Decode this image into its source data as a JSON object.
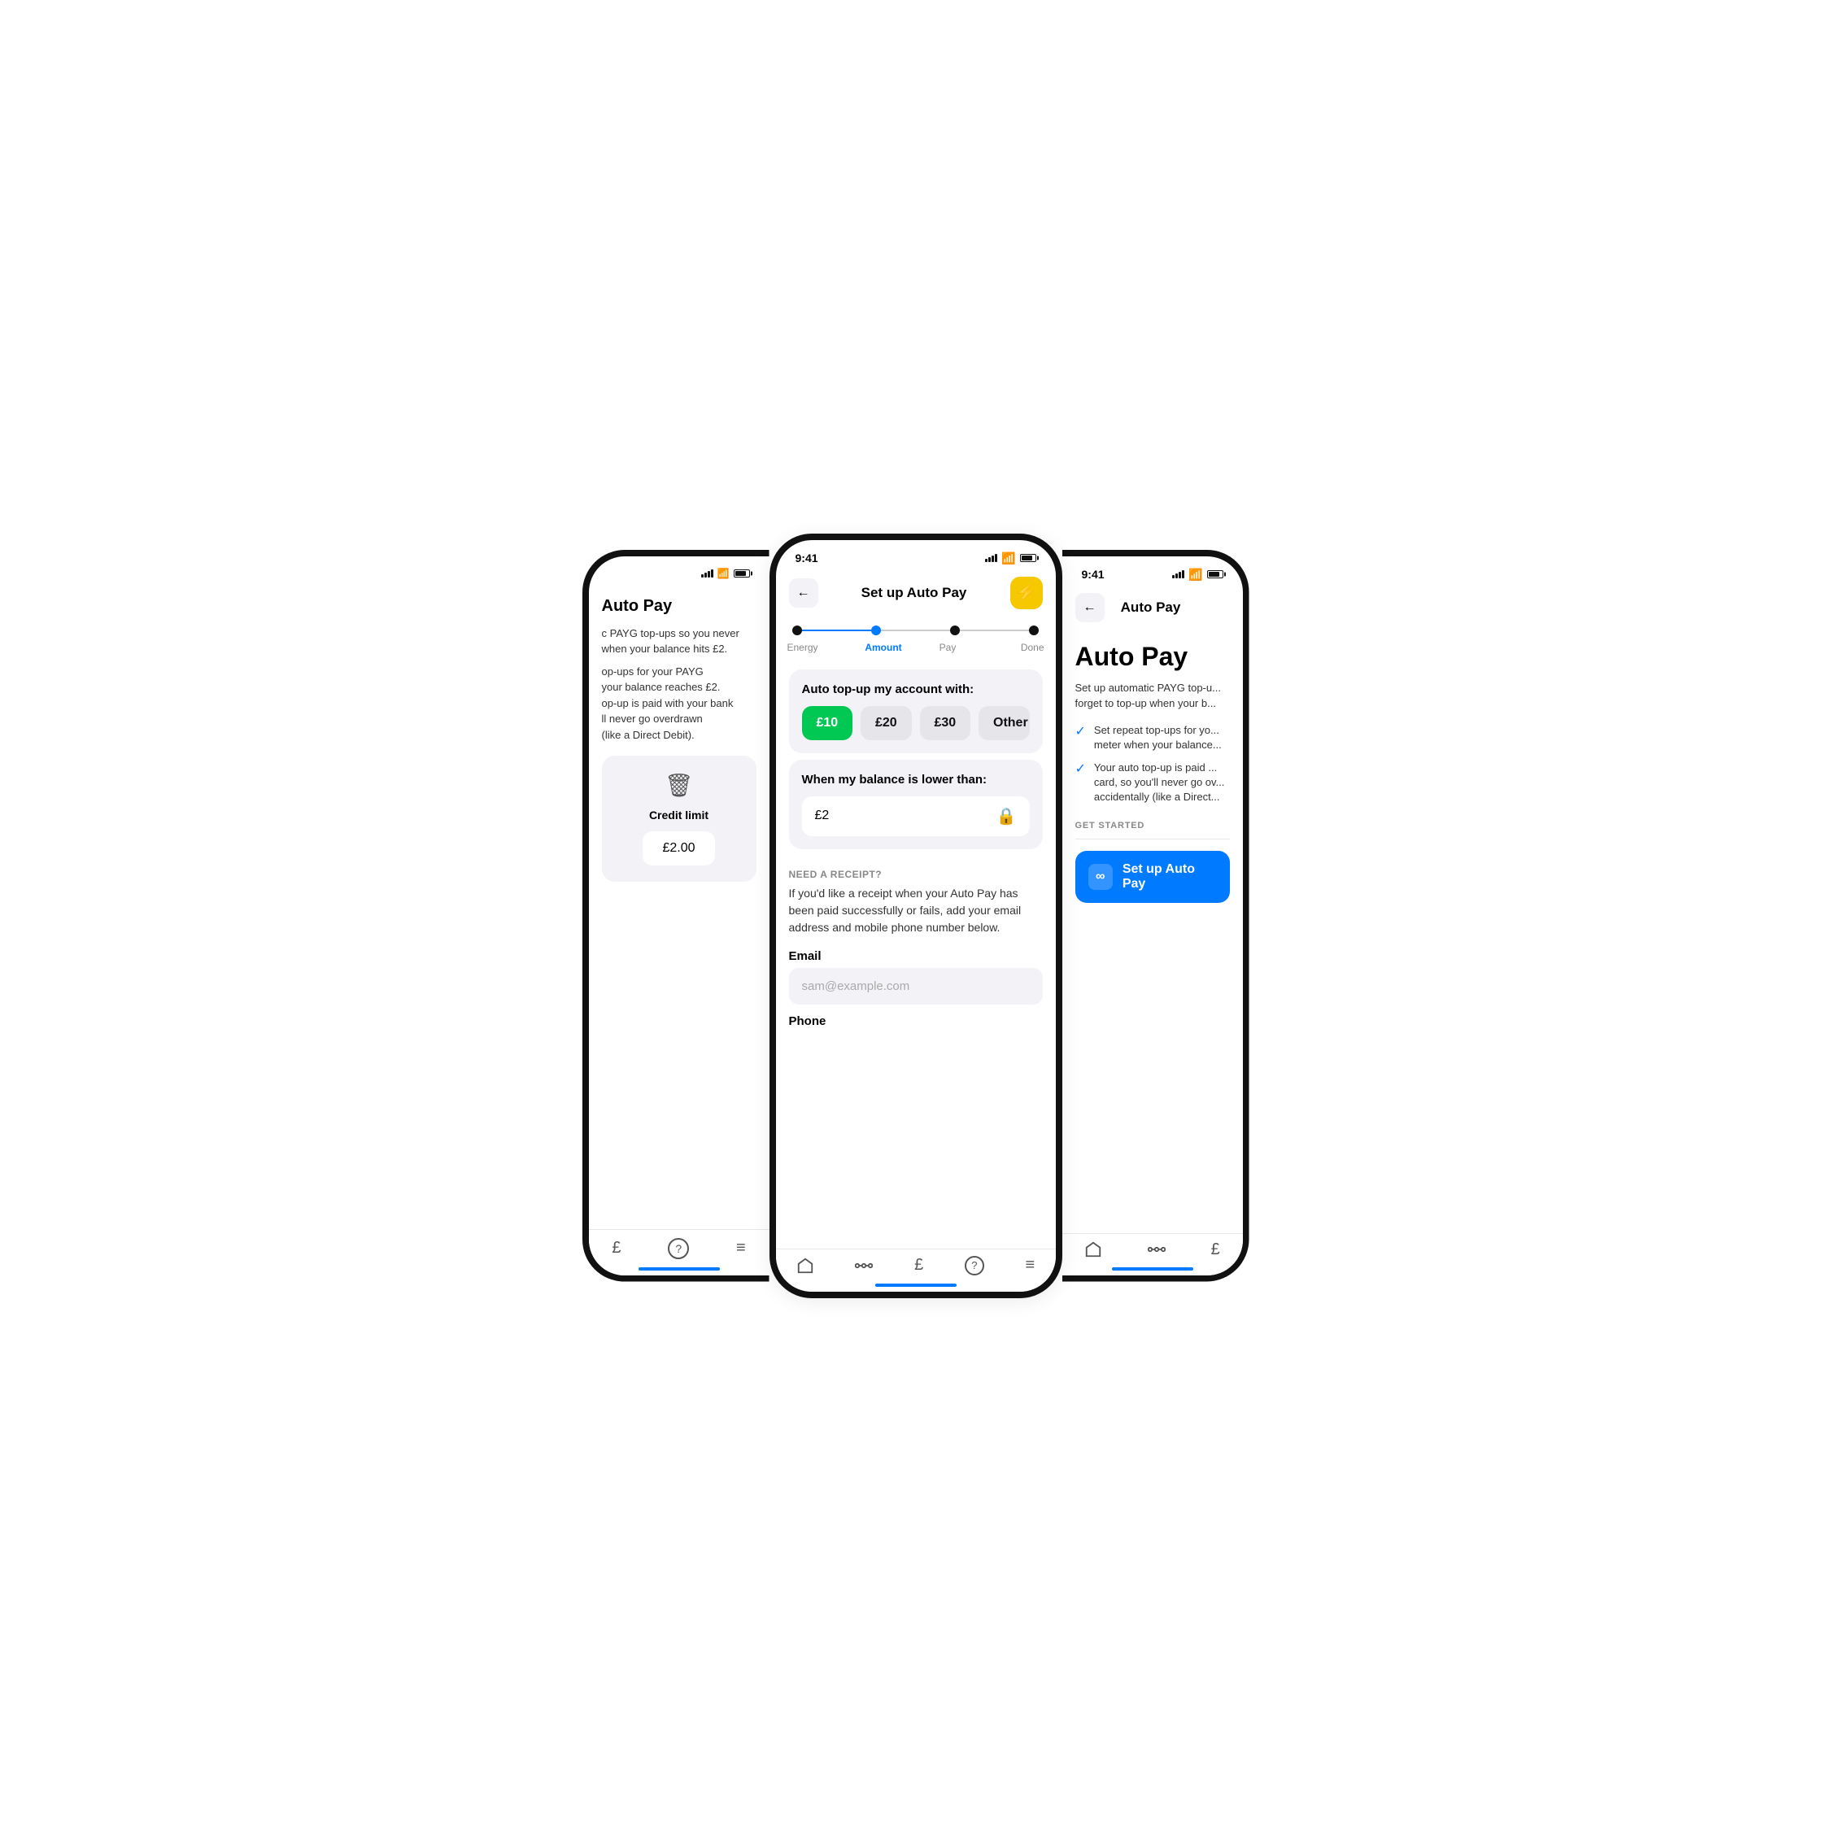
{
  "phones": {
    "left": {
      "title": "Auto Pay",
      "desc_line1": "c PAYG top-ups so you never",
      "desc_line2": "when your balance hits £2.",
      "desc_line3": "",
      "desc2_line1": "op-ups for your PAYG",
      "desc2_line2": "your balance reaches £2.",
      "desc2_line3": "op-up is paid with your bank",
      "desc2_line4": "ll never go overdrawn",
      "desc2_line5": "(like a Direct Debit).",
      "credit_label": "Credit limit",
      "credit_value": "£2.00",
      "nav_items": [
        "£",
        "?",
        "≡"
      ]
    },
    "center": {
      "time": "9:41",
      "back_label": "←",
      "title": "Set up Auto Pay",
      "stepper": {
        "steps": [
          "Energy",
          "Amount",
          "Pay",
          "Done"
        ],
        "active_index": 1
      },
      "card1": {
        "title": "Auto top-up my account with:",
        "amounts": [
          "£10",
          "£20",
          "£30",
          "Other"
        ],
        "selected": "£10"
      },
      "card2": {
        "title": "When my balance is lower than:",
        "value": "£2"
      },
      "receipt": {
        "label": "NEED A RECEIPT?",
        "desc": "If you'd like a receipt when your Auto Pay has been paid successfully or fails, add your email address and mobile phone number below.",
        "email_label": "Email",
        "email_placeholder": "sam@example.com",
        "phone_label": "Phone"
      },
      "nav_items": [
        "⌂",
        "◦◦◦",
        "£",
        "?",
        "≡"
      ]
    },
    "right": {
      "time": "9:41",
      "back_label": "←",
      "title": "Auto Pay",
      "heading": "Auto Pay",
      "desc": "Set up automatic PAYG top-u... forget to top-up when your b...",
      "checklist": [
        "Set repeat top-ups for yo... meter when your balance...",
        "Your auto top-up is paid ... card, so you'll never go ov... accidentally (like a Direct..."
      ],
      "get_started_label": "GET STARTED",
      "setup_btn_label": "Set up Auto Pay",
      "nav_items": [
        "⌂",
        "◦◦◦",
        "£"
      ]
    }
  },
  "colors": {
    "accent_blue": "#007aff",
    "accent_green": "#00c853",
    "accent_yellow": "#f5c800",
    "bg_gray": "#f2f2f7",
    "border": "#e5e5ea",
    "text_dark": "#111111",
    "text_muted": "#888888"
  }
}
